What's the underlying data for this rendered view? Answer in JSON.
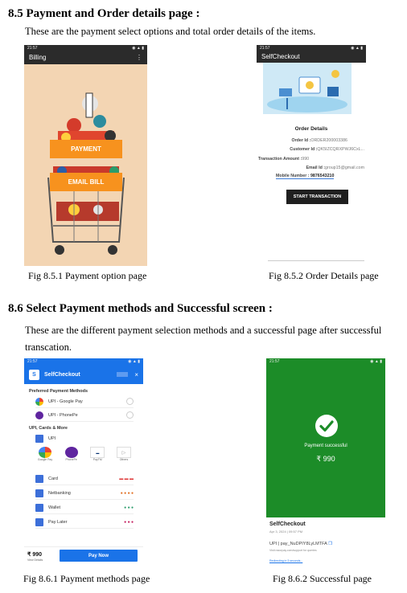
{
  "section1": {
    "heading": "8.5 Payment and Order details page :",
    "text": "These are the payment select options and total order details of the items."
  },
  "billing_screen": {
    "status_time": "21:57",
    "title": "Billing",
    "menu_glyph": "⋮",
    "payment_label": "PAYMENT",
    "email_label": "EMAIL BILL"
  },
  "order_screen": {
    "status_time": "21:57",
    "title": "SelfCheckout",
    "heading": "Order Details",
    "order_id_label": "Order Id :",
    "order_id": "ORDER200003386",
    "customer_id_label": "Customer Id :",
    "customer_id": "QK5IZCQRXPWJ6CxL...",
    "amount_label": "Transaction Amount :",
    "amount": "990",
    "email_label": "Email Id :",
    "email": "group15@gmail.com",
    "mobile_label": "Mobile Number : ",
    "mobile": "9876543210",
    "start_label": "START TRANSACTION"
  },
  "captions": {
    "fig1": "Fig 8.5.1 Payment option page",
    "fig2": "Fig 8.5.2 Order Details page",
    "fig3": "Fig 8.6.1 Payment methods page",
    "fig4": "Fig 8.6.2 Successful page"
  },
  "section2": {
    "heading": "8.6 Select Payment methods and Successful screen :",
    "text_line1": "These are the different payment selection methods and a successful page after successful",
    "text_line2": "transcation."
  },
  "methods_screen": {
    "status_time": "21:57",
    "logo_letter": "S",
    "title": "SelfCheckout",
    "close_glyph": "×",
    "preferred_heading": "Preferred Payment Methods",
    "pref1": "UPI - Google Pay",
    "pref2": "UPI - PhonePe",
    "more_heading": "UPI, Cards & More",
    "upi": "UPI",
    "apps": [
      "Google Pay",
      "PhonePe",
      "PayTM",
      "Others"
    ],
    "methods": [
      "Card",
      "Netbanking",
      "Wallet",
      "Pay Later"
    ],
    "total": "₹ 990",
    "view_details": "View Details",
    "pay_now": "Pay Now"
  },
  "success_screen": {
    "status_time": "21:57",
    "message": "Payment successful",
    "amount": "₹ 990",
    "merchant": "SelfCheckout",
    "date": "Apr 3, 2024 | 09:57 PM",
    "payment_ref": "UPI | pay_NuDPIY8LyLMTFA",
    "support_text": "Visit razorpay.com/support for queries",
    "redirecting": "Redirecting in 3 seconds..."
  },
  "colors": {
    "orange": "#f7921e",
    "peach": "#f3d5b3",
    "razorpay_blue": "#1a73e8",
    "success_green": "#1c8c28"
  }
}
